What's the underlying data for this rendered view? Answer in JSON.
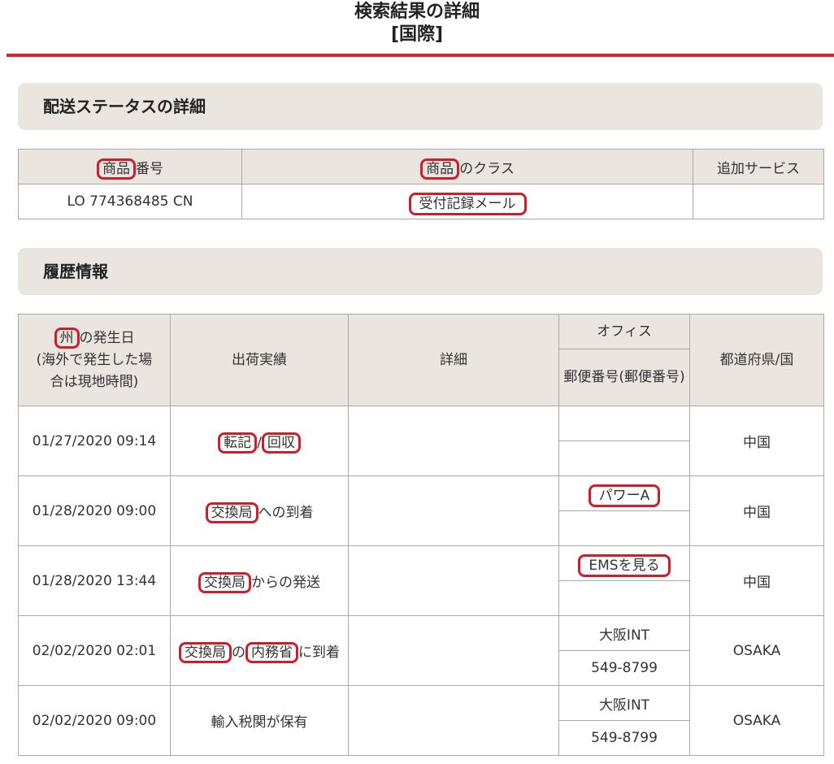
{
  "page": {
    "title_line1": "検索結果の詳細",
    "title_line2": "[国際]"
  },
  "status_section": {
    "heading": "配送ステータスの詳細",
    "headers": {
      "number_pre": "商品",
      "number_post": "番号",
      "class_pre": "商品",
      "class_post": "のクラス",
      "service": "追加サービス"
    },
    "row": {
      "number": "LO 774368485 CN",
      "class": "受付記録メール",
      "service": ""
    }
  },
  "history_section": {
    "heading": "履歴情報",
    "headers": {
      "date_mark": "州",
      "date_rest": "の発生日",
      "date_note1": "(海外で発生した場",
      "date_note2": "合は現地時間)",
      "result": "出荷実績",
      "detail": "詳細",
      "office": "オフィス",
      "postal": "郵便番号(郵便番号)",
      "region": "都道府県/国"
    },
    "rows": [
      {
        "date": "01/27/2020 09:14",
        "result_a": "転記",
        "result_sep": "/",
        "result_b": "回収",
        "detail": "",
        "office": "",
        "postal": "",
        "region": "中国"
      },
      {
        "date": "01/28/2020 09:00",
        "result_a": "交換局",
        "result_rest": "への到着",
        "detail": "",
        "office": "パワーA",
        "postal": "",
        "region": "中国"
      },
      {
        "date": "01/28/2020 13:44",
        "result_a": "交換局",
        "result_rest": "からの発送",
        "detail": "",
        "office": "EMSを見る",
        "postal": "",
        "region": "中国"
      },
      {
        "date": "02/02/2020 02:01",
        "result_a": "交換局",
        "result_mid": "の",
        "result_b": "内務省",
        "result_rest": "に到着",
        "detail": "",
        "office": "大阪INT",
        "postal": "549-8799",
        "region": "OSAKA"
      },
      {
        "date": "02/02/2020 09:00",
        "result_a": "輸入税関が保有",
        "detail": "",
        "office": "大阪INT",
        "postal": "549-8799",
        "region": "OSAKA"
      }
    ]
  },
  "colors": {
    "accent_red": "#d0282d",
    "annotation_red": "#cc1e2b",
    "header_bg": "#ebe5e0"
  }
}
